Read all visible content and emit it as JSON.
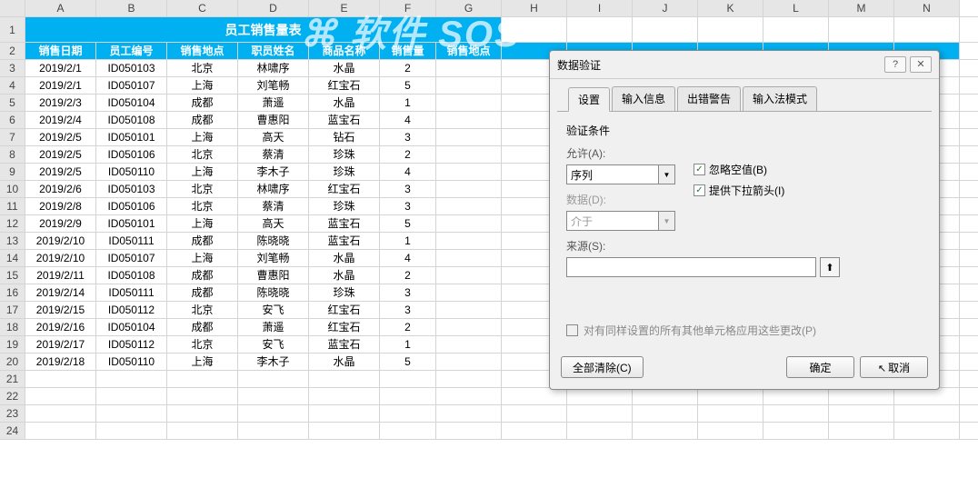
{
  "columns": [
    "A",
    "B",
    "C",
    "D",
    "E",
    "F",
    "G",
    "H",
    "I",
    "J",
    "K",
    "L",
    "M",
    "N"
  ],
  "table_title": "员工销售量表",
  "headers": [
    "销售日期",
    "员工编号",
    "销售地点",
    "职员姓名",
    "商品名称",
    "销售量",
    "销售地点"
  ],
  "rows": [
    [
      "2019/2/1",
      "ID050103",
      "北京",
      "林啸序",
      "水晶",
      "2",
      ""
    ],
    [
      "2019/2/1",
      "ID050107",
      "上海",
      "刘笔畅",
      "红宝石",
      "5",
      ""
    ],
    [
      "2019/2/3",
      "ID050104",
      "成都",
      "萧遥",
      "水晶",
      "1",
      ""
    ],
    [
      "2019/2/4",
      "ID050108",
      "成都",
      "曹惠阳",
      "蓝宝石",
      "4",
      ""
    ],
    [
      "2019/2/5",
      "ID050101",
      "上海",
      "高天",
      "钻石",
      "3",
      ""
    ],
    [
      "2019/2/5",
      "ID050106",
      "北京",
      "蔡清",
      "珍珠",
      "2",
      ""
    ],
    [
      "2019/2/5",
      "ID050110",
      "上海",
      "李木子",
      "珍珠",
      "4",
      ""
    ],
    [
      "2019/2/6",
      "ID050103",
      "北京",
      "林啸序",
      "红宝石",
      "3",
      ""
    ],
    [
      "2019/2/8",
      "ID050106",
      "北京",
      "蔡清",
      "珍珠",
      "3",
      ""
    ],
    [
      "2019/2/9",
      "ID050101",
      "上海",
      "高天",
      "蓝宝石",
      "5",
      ""
    ],
    [
      "2019/2/10",
      "ID050111",
      "成都",
      "陈晓晓",
      "蓝宝石",
      "1",
      ""
    ],
    [
      "2019/2/10",
      "ID050107",
      "上海",
      "刘笔畅",
      "水晶",
      "4",
      ""
    ],
    [
      "2019/2/11",
      "ID050108",
      "成都",
      "曹惠阳",
      "水晶",
      "2",
      ""
    ],
    [
      "2019/2/14",
      "ID050111",
      "成都",
      "陈晓晓",
      "珍珠",
      "3",
      ""
    ],
    [
      "2019/2/15",
      "ID050112",
      "北京",
      "安飞",
      "红宝石",
      "3",
      ""
    ],
    [
      "2019/2/16",
      "ID050104",
      "成都",
      "萧遥",
      "红宝石",
      "2",
      ""
    ],
    [
      "2019/2/17",
      "ID050112",
      "北京",
      "安飞",
      "蓝宝石",
      "1",
      ""
    ],
    [
      "2019/2/18",
      "ID050110",
      "上海",
      "李木子",
      "水晶",
      "5",
      ""
    ]
  ],
  "empty_rows": [
    21,
    22,
    23,
    24
  ],
  "watermark": "软件 SOS",
  "dialog": {
    "title": "数据验证",
    "help_icon": "?",
    "close_icon": "✕",
    "tabs": [
      "设置",
      "输入信息",
      "出错警告",
      "输入法模式"
    ],
    "section": "验证条件",
    "allow_label": "允许(A):",
    "allow_value": "序列",
    "data_label": "数据(D):",
    "data_value": "介于",
    "ignore_blank": "忽略空值(B)",
    "dropdown_arrow": "提供下拉箭头(I)",
    "source_label": "来源(S):",
    "source_value": "",
    "apply_all": "对有同样设置的所有其他单元格应用这些更改(P)",
    "clear_btn": "全部清除(C)",
    "ok_btn": "确定",
    "cancel_btn": "取消"
  }
}
